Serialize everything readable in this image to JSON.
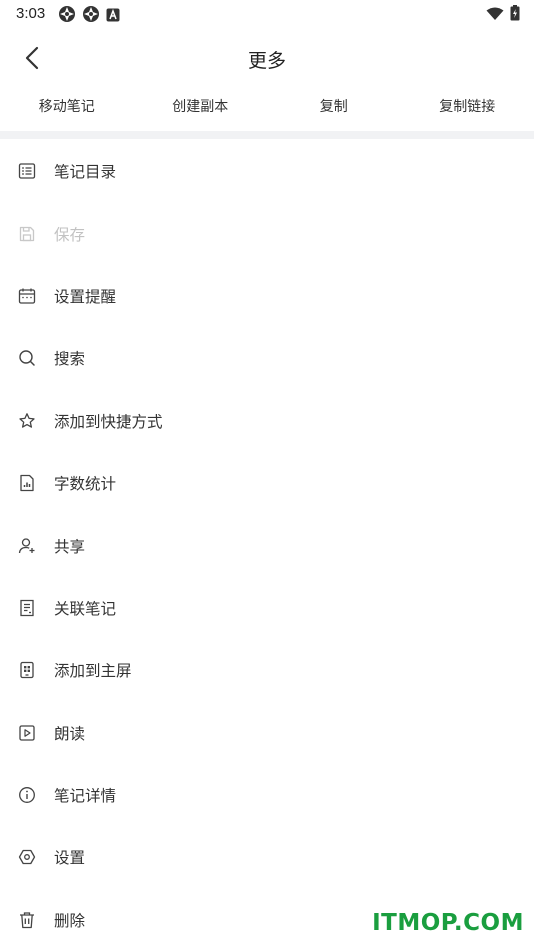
{
  "status_bar": {
    "time": "3:03",
    "left_icons": [
      "app-notification-icon",
      "app-notification-icon",
      "keyboard-a-icon"
    ],
    "right_icons": [
      "wifi-icon",
      "battery-charging-icon"
    ]
  },
  "header": {
    "title": "更多",
    "back_icon": "chevron-left-icon"
  },
  "actions": [
    {
      "label": "移动笔记"
    },
    {
      "label": "创建副本"
    },
    {
      "label": "复制"
    },
    {
      "label": "复制链接"
    }
  ],
  "menu": [
    {
      "label": "笔记目录",
      "icon": "list-outline-icon",
      "enabled": true
    },
    {
      "label": "保存",
      "icon": "save-icon",
      "enabled": false
    },
    {
      "label": "设置提醒",
      "icon": "calendar-icon",
      "enabled": true
    },
    {
      "label": "搜索",
      "icon": "search-icon",
      "enabled": true
    },
    {
      "label": "添加到快捷方式",
      "icon": "star-icon",
      "enabled": true
    },
    {
      "label": "字数统计",
      "icon": "document-chart-icon",
      "enabled": true
    },
    {
      "label": "共享",
      "icon": "share-user-icon",
      "enabled": true
    },
    {
      "label": "关联笔记",
      "icon": "linked-note-icon",
      "enabled": true
    },
    {
      "label": "添加到主屏",
      "icon": "home-screen-icon",
      "enabled": true
    },
    {
      "label": "朗读",
      "icon": "play-icon",
      "enabled": true
    },
    {
      "label": "笔记详情",
      "icon": "info-icon",
      "enabled": true
    },
    {
      "label": "设置",
      "icon": "settings-icon",
      "enabled": true
    },
    {
      "label": "删除",
      "icon": "trash-icon",
      "enabled": true
    }
  ],
  "watermark": {
    "text": "ITMOP.COM"
  },
  "colors": {
    "text": "#333333",
    "disabled": "#c2c2c2",
    "divider": "#f1f2f4",
    "watermark": "#1a9e3f"
  }
}
